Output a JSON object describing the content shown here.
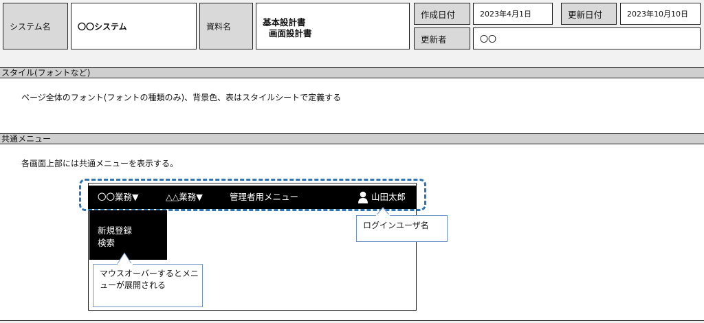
{
  "header": {
    "system_label": "システム名",
    "system_value": "〇〇システム",
    "doc_label": "資料名",
    "doc_title_1": "基本設計書",
    "doc_title_2": "画面設計書",
    "created_label": "作成日付",
    "created_value": "2023年4月1日",
    "updated_label": "更新日付",
    "updated_value": "2023年10月10日",
    "updater_label": "更新者",
    "updater_value": "〇〇"
  },
  "sections": {
    "style_heading": "スタイル(フォントなど)",
    "style_body": "ページ全体のフォント(フォントの種類のみ)、背景色、表はスタイルシートで定義する",
    "menu_heading": "共通メニュー",
    "menu_body": "各画面上部には共通メニューを表示する。"
  },
  "mock": {
    "menu_items": [
      "〇〇業務▼",
      "△△業務▼",
      "管理者用メニュー"
    ],
    "user_name": "山田太郎",
    "dropdown_items": [
      "新規登録",
      "検索"
    ],
    "callout_hover": "マウスオーバーするとメニューが展開される",
    "callout_user": "ログインユーザ名",
    "highlight_color": "#2e74b5"
  }
}
